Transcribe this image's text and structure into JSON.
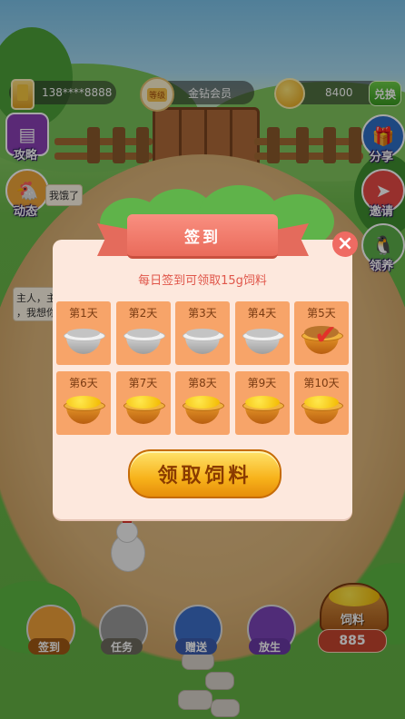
{
  "status_bar": {
    "phone": "138****8888",
    "vip_badge": "等级",
    "vip_label": "金钻会员",
    "coins": "8400",
    "exchange_label": "兑换"
  },
  "left_buttons": [
    {
      "label": "攻略",
      "icon": "book-icon",
      "color": "#8b3fb6"
    },
    {
      "label": "动态",
      "icon": "chicken-icon",
      "color": "#f0a63a"
    }
  ],
  "hungry_bubble": "我饿了",
  "speech_bubble": "主人，主\n，我想你",
  "right_buttons": [
    {
      "label": "分享",
      "icon": "gift-icon",
      "color": "#2f6fc7"
    },
    {
      "label": "邀请",
      "icon": "paper-plane-icon",
      "color": "#e84a45"
    },
    {
      "label": "领养",
      "icon": "penguin-icon",
      "color": "#5db04a"
    }
  ],
  "dialog": {
    "title": "签到",
    "close_icon": "close-icon",
    "subtitle": "每日签到可领取15g饲料",
    "days": [
      {
        "label": "第1天",
        "state": "done"
      },
      {
        "label": "第2天",
        "state": "done"
      },
      {
        "label": "第3天",
        "state": "done"
      },
      {
        "label": "第4天",
        "state": "done"
      },
      {
        "label": "第5天",
        "state": "today"
      },
      {
        "label": "第6天",
        "state": "pending"
      },
      {
        "label": "第7天",
        "state": "pending"
      },
      {
        "label": "第8天",
        "state": "pending"
      },
      {
        "label": "第9天",
        "state": "pending"
      },
      {
        "label": "第10天",
        "state": "pending"
      }
    ],
    "claim_button": "领取饲料"
  },
  "bottom_nav": [
    {
      "label": "签到",
      "icon": "sign-in-icon",
      "color": "#f2a23a",
      "label_color": "#a15a14"
    },
    {
      "label": "任务",
      "icon": "task-icon",
      "color": "#9a9a9a",
      "label_color": "#6e6a5e"
    },
    {
      "label": "赠送",
      "icon": "gift-people-icon",
      "color": "#3d6fc9",
      "label_color": "#3b5db0"
    },
    {
      "label": "放生",
      "icon": "chicken-release-icon",
      "color": "#7b44b8",
      "label_color": "#6a3aa6"
    }
  ],
  "feed": {
    "label": "饲料",
    "count": "885"
  }
}
